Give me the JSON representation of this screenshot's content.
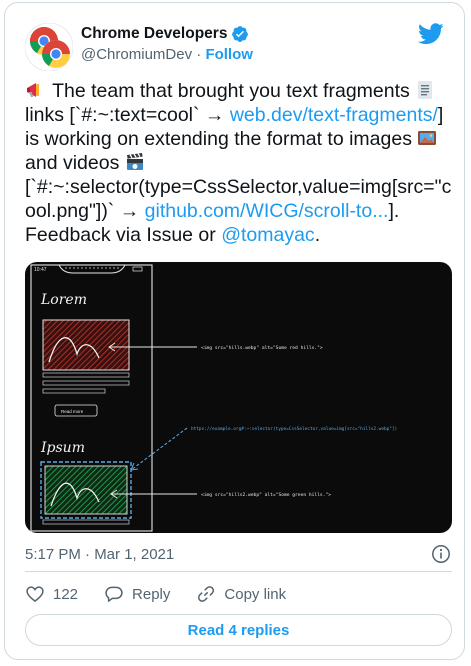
{
  "author": {
    "name": "Chrome Developers",
    "handle": "@ChromiumDev",
    "separator": "·",
    "follow_label": "Follow"
  },
  "tweet": {
    "part1": " The team that brought you text fragments ",
    "part2": " links [`#:~:text=cool` → ",
    "link1": "web.dev/text-fragments/",
    "part3": "] is working on extending the format to images ",
    "part4": " and videos ",
    "part5": "[`#:~:selector(type=CssSelector,value=img[src=\"cool.png\"])` → ",
    "link2": "github.com/WICG/scroll-to...",
    "part6": "]. Feedback via Issue or ",
    "mention": "@tomayac",
    "part7": "."
  },
  "media": {
    "status_time": "10:47",
    "heading1": "Lorem",
    "heading2": "Ipsum",
    "button_label": "Read more",
    "annotation1": "<img src=\"hills.webp\" alt=\"Some red hills.\">",
    "annotation2": "https://example.org#:~:selector(type=CssSelector,value=img[src=\"hills2.webp\"])",
    "annotation3": "<img src=\"hills2.webp\" alt=\"Some green hills.\">"
  },
  "meta": {
    "timestamp": "5:17 PM · Mar 1, 2021"
  },
  "actions": {
    "like_count": "122",
    "reply_label": "Reply",
    "copy_label": "Copy link",
    "read_replies_label": "Read 4 replies"
  },
  "icons": {
    "avatar": "chrome-logo-icon",
    "verified": "verified-badge-icon",
    "brand": "twitter-bird-icon",
    "info": "info-icon",
    "like": "heart-icon",
    "reply": "reply-bubble-icon",
    "copy": "link-icon",
    "emoji1": "megaphone-emoji-icon",
    "emoji2": "document-emoji-icon",
    "emoji3": "picture-emoji-icon",
    "emoji4": "clapper-emoji-icon"
  },
  "colors": {
    "accent": "#1d9bf0",
    "text": "#0f1419",
    "muted": "#536471",
    "border": "#cfd9de"
  }
}
